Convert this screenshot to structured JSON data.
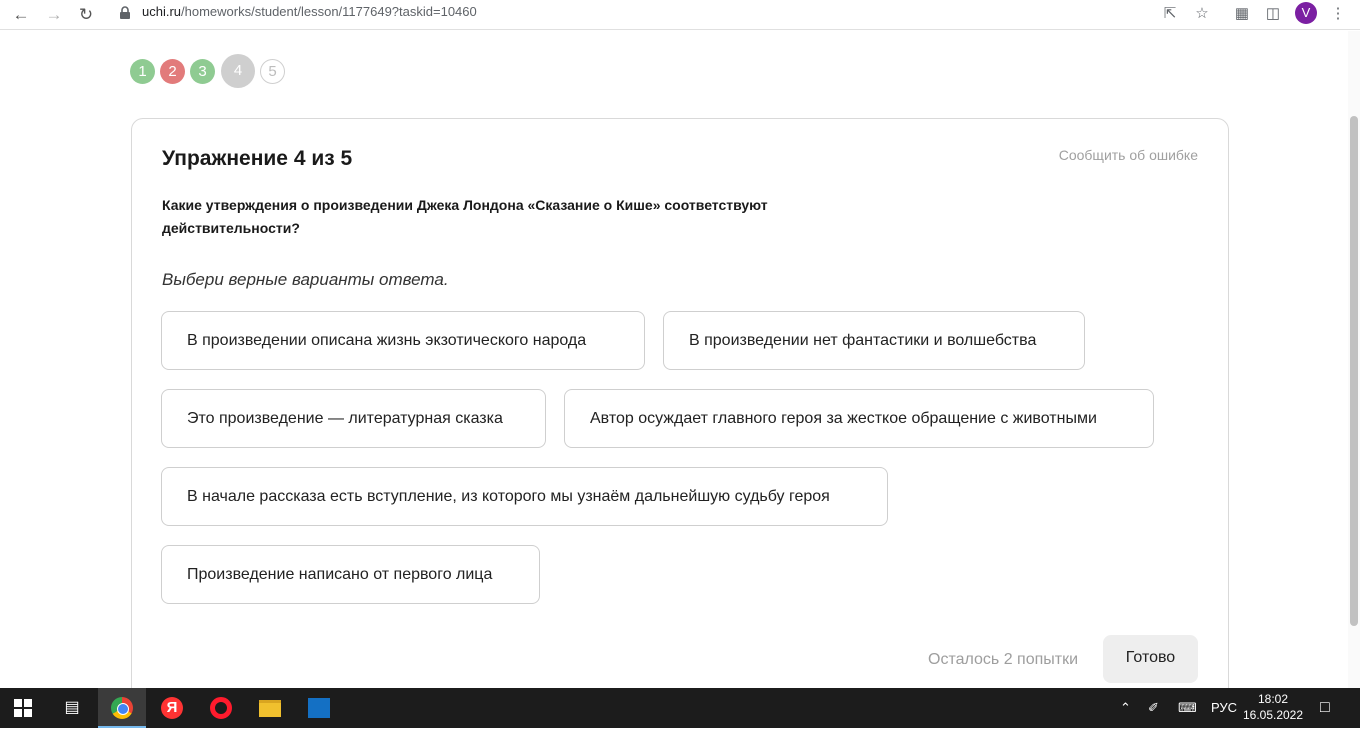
{
  "browser": {
    "url_host": "uchi.ru",
    "url_path": "/homeworks/student/lesson/1177649?taskid=10460",
    "profile_initial": "V"
  },
  "steps": [
    {
      "label": "1",
      "state": "correct"
    },
    {
      "label": "2",
      "state": "wrong"
    },
    {
      "label": "3",
      "state": "correct"
    },
    {
      "label": "4",
      "state": "current"
    },
    {
      "label": "5",
      "state": "pending"
    }
  ],
  "exercise": {
    "title": "Упражнение 4 из 5",
    "report_link": "Сообщить об ошибке",
    "question": "Какие утверждения о произведении Джека Лондона «Сказание о Кише» соответствуют действительности?",
    "hint": "Выбери верные варианты ответа.",
    "options": [
      "В произведении описана жизнь экзотического народа",
      "В произведении нет фантастики и волшебства",
      "Это произведение — литературная сказка",
      "Автор осуждает главного героя за жесткое обращение с животными",
      "В начале рассказа есть вступление, из которого мы узнаём дальнейшую судьбу героя",
      "Произведение написано от первого лица"
    ],
    "attempts": "Осталось 2 попытки",
    "done_label": "Готово"
  },
  "taskbar": {
    "language": "РУС",
    "time": "18:02",
    "date": "16.05.2022"
  },
  "colors": {
    "step_correct": "#8fcb92",
    "step_wrong": "#e27b7b",
    "step_current": "#cfcfcf"
  }
}
